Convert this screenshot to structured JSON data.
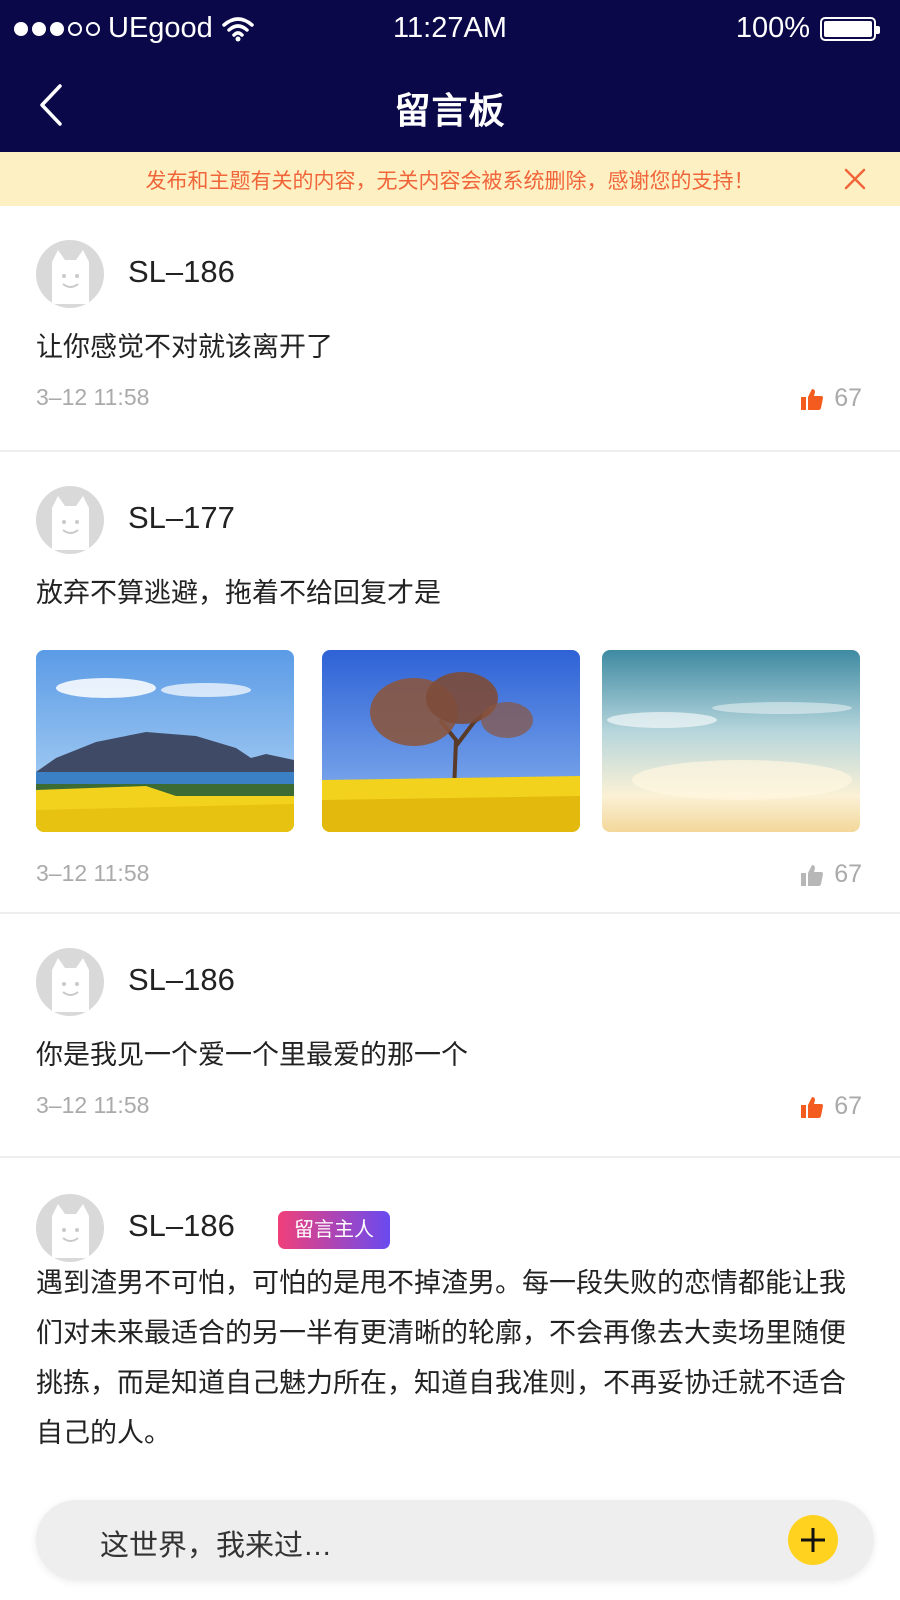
{
  "status_bar": {
    "carrier": "UEgood",
    "time": "11:27AM",
    "battery": "100%"
  },
  "header": {
    "title": "留言板"
  },
  "notice": {
    "text": "发布和主题有关的内容，无关内容会被系统删除，感谢您的支持！"
  },
  "colors": {
    "nav_bg": "#0a0848",
    "notice_bg": "#fdf1c4",
    "notice_text": "#f0663a",
    "like_active": "#f45b1f",
    "like_inactive": "#b7b7b7",
    "add_button": "#ffd21f"
  },
  "posts": [
    {
      "username": "SL–186",
      "content": "让你感觉不对就该离开了",
      "time": "3–12 11:58",
      "likes": "67"
    },
    {
      "username": "SL–177",
      "content": "放弃不算逃避，拖着不给回复才是",
      "time": "3–12 11:58",
      "likes": "67"
    },
    {
      "username": "SL–186",
      "content": "你是我见一个爱一个里最爱的那一个",
      "time": "3–12 11:58",
      "likes": "67"
    },
    {
      "username": "SL–186",
      "badge": "留言主人",
      "content": "遇到渣男不可怕，可怕的是甩不掉渣男。每一段失败的恋情都能让我们对未来最适合的另一半有更清晰的轮廓，不会再像去大卖场里随便挑拣，而是知道自己魅力所在，知道自我准则，不再妥协迁就不适合自己的人。"
    }
  ],
  "composer": {
    "placeholder": "这世界，我来过…"
  }
}
